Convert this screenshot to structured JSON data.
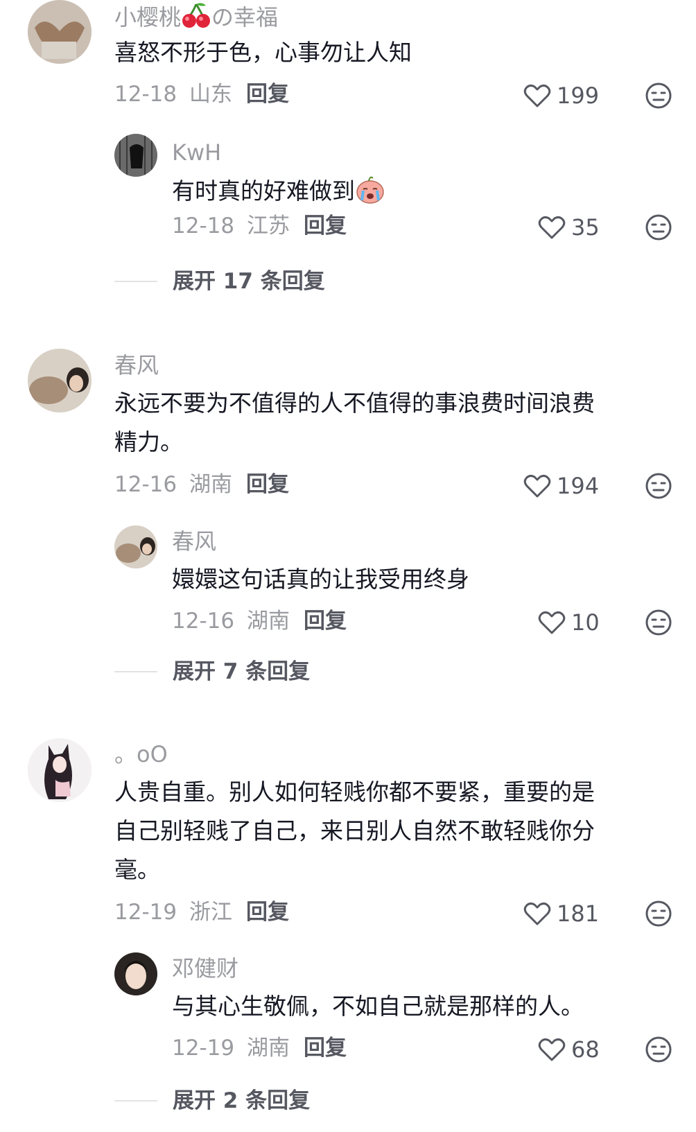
{
  "comments": [
    {
      "user": "小樱桃",
      "user_suffix": "の幸福",
      "user_emoji": "cherry-emoji",
      "text": "喜怒不形于色，心事勿让人知",
      "date": "12-18",
      "location": "山东",
      "reply_label": "回复",
      "likes": "199",
      "reply": {
        "user": "KwH",
        "text": "有时真的好难做到",
        "text_emoji": "crying-face-emoji",
        "date": "12-18",
        "location": "江苏",
        "reply_label": "回复",
        "likes": "35"
      },
      "expand_label": "展开 17 条回复"
    },
    {
      "user": "春风",
      "text_line1": "永远不要为不值得的人不值得的事浪费时间浪费",
      "text_line2": "精力。",
      "date": "12-16",
      "location": "湖南",
      "reply_label": "回复",
      "likes": "194",
      "reply": {
        "user": "春风",
        "text": "嬛嬛这句话真的让我受用终身",
        "date": "12-16",
        "location": "湖南",
        "reply_label": "回复",
        "likes": "10"
      },
      "expand_label": "展开 7 条回复"
    },
    {
      "user": "。oO",
      "text_line1": "人贵自重。别人如何轻贱你都不要紧，重要的是",
      "text_line2": "自己别轻贱了自己，来日别人自然不敢轻贱你分",
      "text_line3": "毫。",
      "date": "12-19",
      "location": "浙江",
      "reply_label": "回复",
      "likes": "181",
      "reply": {
        "user": "邓健财",
        "text": "与其心生敬佩，不如自己就是那样的人。",
        "date": "12-19",
        "location": "湖南",
        "reply_label": "回复",
        "likes": "68"
      },
      "expand_label": "展开 2 条回复"
    }
  ],
  "colors": {
    "username": "#9a9ba0",
    "text": "#161823",
    "meta": "#9a9ba0",
    "action": "#565861",
    "divider": "#e3e3e4"
  }
}
